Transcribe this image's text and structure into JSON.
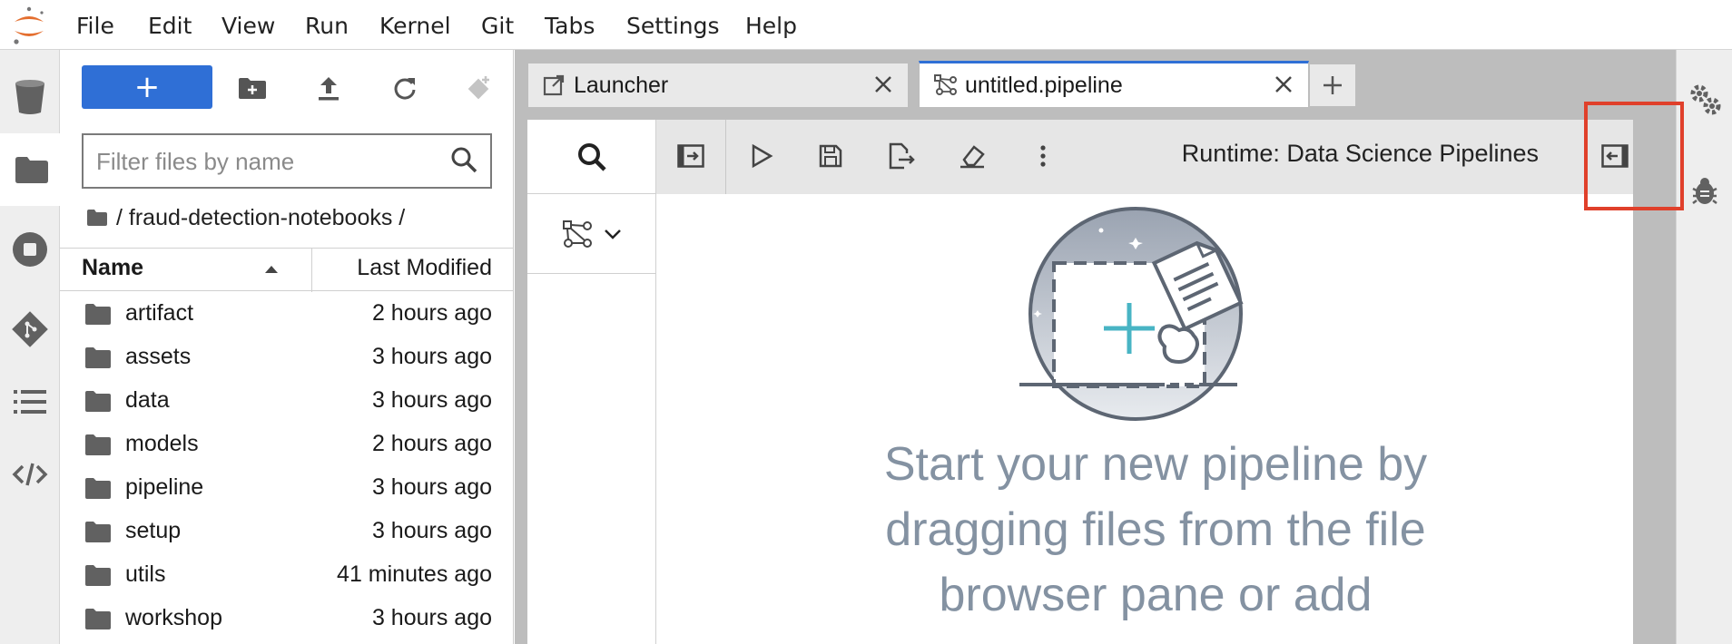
{
  "menu": [
    "File",
    "Edit",
    "View",
    "Run",
    "Kernel",
    "Git",
    "Tabs",
    "Settings",
    "Help"
  ],
  "filebrowser": {
    "new_button_label": "+",
    "filter_placeholder": "Filter files by name",
    "breadcrumb_path": "/ fraud-detection-notebooks /",
    "columns": {
      "name": "Name",
      "modified": "Last Modified"
    },
    "files": [
      {
        "name": "artifact",
        "modified": "2 hours ago"
      },
      {
        "name": "assets",
        "modified": "3 hours ago"
      },
      {
        "name": "data",
        "modified": "3 hours ago"
      },
      {
        "name": "models",
        "modified": "2 hours ago"
      },
      {
        "name": "pipeline",
        "modified": "3 hours ago"
      },
      {
        "name": "setup",
        "modified": "3 hours ago"
      },
      {
        "name": "utils",
        "modified": "41 minutes ago"
      },
      {
        "name": "workshop",
        "modified": "3 hours ago"
      }
    ]
  },
  "tabs": [
    {
      "label": "Launcher",
      "icon": "launch-icon"
    },
    {
      "label": "untitled.pipeline",
      "icon": "pipeline-icon",
      "active": true
    }
  ],
  "pipeline": {
    "runtime_label": "Runtime: Data Science Pipelines",
    "empty_message": "Start your new pipeline by dragging files from the file browser pane or add"
  },
  "colors": {
    "accent": "#2f6fd6",
    "highlight": "#e0402b",
    "empty_text": "#8492a2"
  }
}
